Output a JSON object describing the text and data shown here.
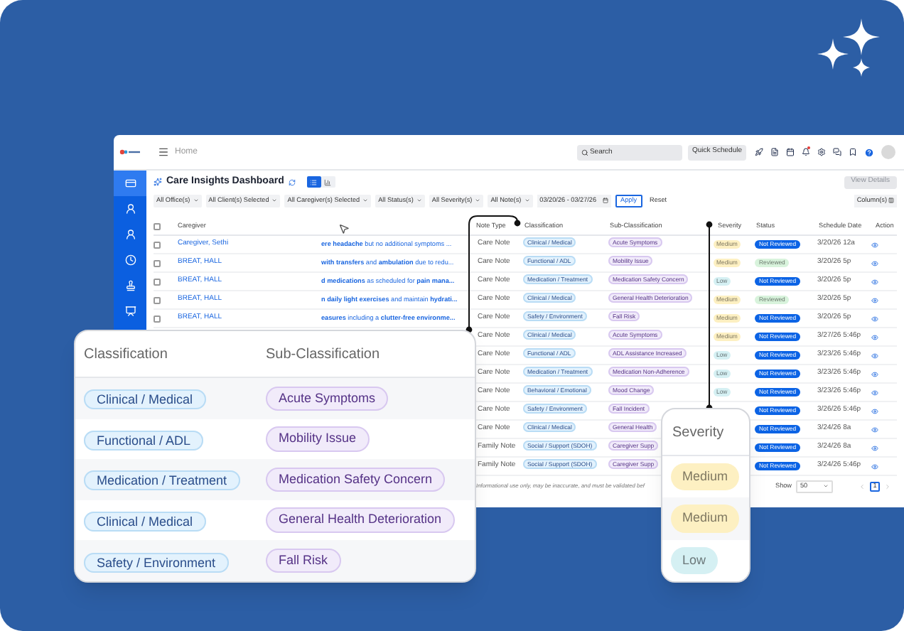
{
  "header": {
    "breadcrumb": "Home",
    "search_placeholder": "Search",
    "quick_schedule": "Quick Schedule",
    "has_notification": true
  },
  "sidebar": {
    "items": [
      {
        "selected": true
      },
      {
        "selected": false
      },
      {
        "selected": false
      },
      {
        "selected": false
      },
      {
        "selected": false
      },
      {
        "selected": false
      }
    ]
  },
  "dashboard": {
    "title": "Care Insights Dashboard",
    "views": [
      {
        "selected": true
      },
      {
        "selected": false
      }
    ],
    "view_details": {
      "label": "View Details",
      "disabled": true
    }
  },
  "filters": {
    "dropdowns": [
      "All Office(s)",
      "All Client(s) Selected",
      "All Caregiver(s) Selected",
      "All Status(s)",
      "All Severity(s)",
      "All Note(s)"
    ],
    "date_range": "03/20/26 - 03/27/26",
    "apply": "Apply",
    "reset": "Reset",
    "columns": "Column(s)"
  },
  "table": {
    "all_checked": false,
    "columns": [
      "Caregiver",
      "Note Type",
      "Classification",
      "Sub-Classification",
      "Severity",
      "Status",
      "Schedule Date",
      "Action"
    ],
    "rows": [
      {
        "checked": false,
        "caregiver": "Caregiver, Sethi",
        "note": "**ere headache** but no additional symptoms ...",
        "note_type": "Care Note",
        "classification": "Clinical / Medical",
        "sub_classification": "Acute Symptoms",
        "severity": {
          "label": "Medium",
          "color": "#fdf0c2"
        },
        "status": {
          "label": "Not Reviewed",
          "color": "#0b63e5"
        },
        "schedule_date": "3/20/26 12a"
      },
      {
        "checked": false,
        "caregiver": "BREAT, HALL",
        "note": "**with transfers** and **ambulation** due to redu...",
        "note_type": "Care Note",
        "classification": "Functional / ADL",
        "sub_classification": "Mobility Issue",
        "severity": {
          "label": "Medium",
          "color": "#fdf0c2"
        },
        "status": {
          "label": "Reviewed",
          "color": "#d8f3dc"
        },
        "schedule_date": "3/20/26 5p"
      },
      {
        "checked": false,
        "caregiver": "BREAT, HALL",
        "note": "**d medications** as scheduled for **pain mana...**",
        "note_type": "Care Note",
        "classification": "Medication / Treatment",
        "sub_classification": "Medication Safety Concern",
        "severity": {
          "label": "Low",
          "color": "#d5f0f3"
        },
        "status": {
          "label": "Not Reviewed",
          "color": "#0b63e5"
        },
        "schedule_date": "3/20/26 5p"
      },
      {
        "checked": false,
        "caregiver": "BREAT, HALL",
        "note": "**n daily light exercises** and maintain **hydrati...**",
        "note_type": "Care Note",
        "classification": "Clinical / Medical",
        "sub_classification": "General Health Deterioration",
        "severity": {
          "label": "Medium",
          "color": "#fdf0c2"
        },
        "status": {
          "label": "Reviewed",
          "color": "#d8f3dc"
        },
        "schedule_date": "3/20/26 5p"
      },
      {
        "checked": false,
        "caregiver": "BREAT, HALL",
        "note": "**easures** including a **clutter-free environme...**",
        "note_type": "Care Note",
        "classification": "Safety / Environment",
        "sub_classification": "Fall Risk",
        "severity": {
          "label": "Medium",
          "color": "#fdf0c2"
        },
        "status": {
          "label": "Not Reviewed",
          "color": "#0b63e5"
        },
        "schedule_date": "3/20/26 5p"
      },
      {
        "note_type": "Care Note",
        "classification": "Clinical / Medical",
        "sub_classification": "Acute Symptoms",
        "severity": {
          "label": "Medium",
          "color": "#fdf0c2"
        },
        "status": {
          "label": "Not Reviewed",
          "color": "#0b63e5"
        },
        "schedule_date": "3/27/26 5:46p"
      },
      {
        "note_type": "Care Note",
        "classification": "Functional / ADL",
        "sub_classification": "ADL Assistance Increased",
        "severity": {
          "label": "Low",
          "color": "#d5f0f3"
        },
        "status": {
          "label": "Not Reviewed",
          "color": "#0b63e5"
        },
        "schedule_date": "3/23/26 5:46p"
      },
      {
        "note_type": "Care Note",
        "classification": "Medication / Treatment",
        "sub_classification": "Medication Non-Adherence",
        "severity": {
          "label": "Low",
          "color": "#d5f0f3"
        },
        "status": {
          "label": "Not Reviewed",
          "color": "#0b63e5"
        },
        "schedule_date": "3/23/26 5:46p"
      },
      {
        "note_type": "Care Note",
        "classification": "Behavioral / Emotional",
        "sub_classification": "Mood Change",
        "severity": {
          "label": "Low",
          "color": "#d5f0f3"
        },
        "status": {
          "label": "Not Reviewed",
          "color": "#0b63e5"
        },
        "schedule_date": "3/23/26 5:46p"
      },
      {
        "note_type": "Care Note",
        "classification": "Safety / Environment",
        "sub_classification": "Fall Incident",
        "status": {
          "label": "Not Reviewed",
          "color": "#0b63e5"
        },
        "schedule_date": "3/26/26 5:46p"
      },
      {
        "note_type": "Care Note",
        "classification": "Clinical / Medical",
        "sub_classification": "General Health",
        "status": {
          "label": "Not Reviewed",
          "color": "#0b63e5"
        },
        "schedule_date": "3/24/26 8a"
      },
      {
        "note_type": "Family Note",
        "classification": "Social / Support (SDOH)",
        "sub_classification": "Caregiver Supp",
        "status": {
          "label": "Not Reviewed",
          "color": "#0b63e5"
        },
        "schedule_date": "3/24/26 8a"
      },
      {
        "note_type": "Family Note",
        "classification": "Social / Support (SDOH)",
        "sub_classification": "Caregiver Supp",
        "status": {
          "label": "Not Reviewed",
          "color": "#0b63e5"
        },
        "schedule_date": "3/24/26 5:46p"
      }
    ]
  },
  "footer": {
    "disclaimer": "Informational use only, may be inaccurate, and must be validated bef",
    "show_label": "Show",
    "page_size": "50",
    "page": "1"
  },
  "classification_callout": {
    "columns": [
      "Classification",
      "Sub-Classification"
    ],
    "rows": [
      {
        "classification": "Clinical / Medical",
        "sub_classification": "Acute Symptoms"
      },
      {
        "classification": "Functional / ADL",
        "sub_classification": "Mobility Issue"
      },
      {
        "classification": "Medication / Treatment",
        "sub_classification": "Medication Safety Concern"
      },
      {
        "classification": "Clinical / Medical",
        "sub_classification": "General Health Deterioration"
      },
      {
        "classification": "Safety / Environment",
        "sub_classification": "Fall Risk"
      }
    ]
  },
  "severity_callout": {
    "column": "Severity",
    "rows": [
      {
        "label": "Medium",
        "color": "#fdf0c2"
      },
      {
        "label": "Medium",
        "color": "#fdf0c2"
      },
      {
        "label": "Low",
        "color": "#d5f0f3"
      }
    ]
  }
}
